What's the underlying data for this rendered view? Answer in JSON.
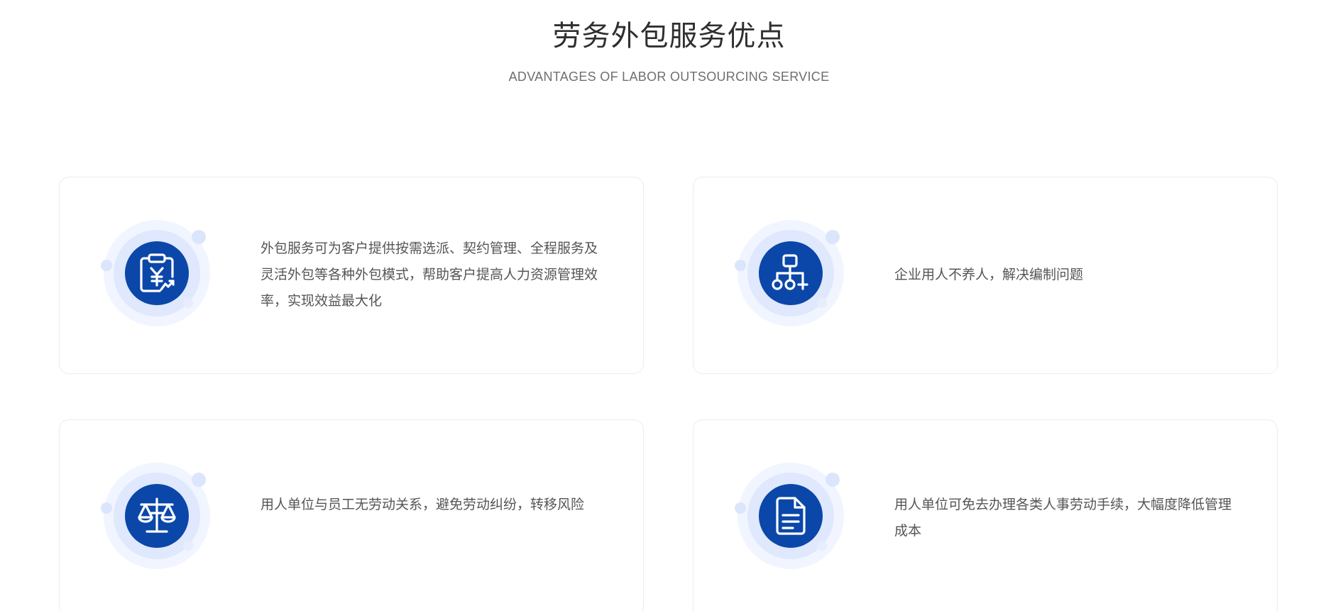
{
  "header": {
    "title": "劳务外包服务优点",
    "subtitle": "ADVANTAGES OF LABOR OUTSOURCING SERVICE"
  },
  "colors": {
    "accent": "#0b47a8",
    "halo_light": "#f1f5ff",
    "halo_mid": "#dfe8fd",
    "card_border": "#ececec"
  },
  "cards": [
    {
      "icon": "clipboard-yuan-icon",
      "text": "外包服务可为客户提供按需选派、契约管理、全程服务及灵活外包等各种外包模式，帮助客户提高人力资源管理效率，实现效益最大化"
    },
    {
      "icon": "org-chart-icon",
      "text": "企业用人不养人，解决编制问题"
    },
    {
      "icon": "scales-icon",
      "text": "用人单位与员工无劳动关系，避免劳动纠纷，转移风险"
    },
    {
      "icon": "document-icon",
      "text": "用人单位可免去办理各类人事劳动手续，大幅度降低管理成本"
    }
  ]
}
